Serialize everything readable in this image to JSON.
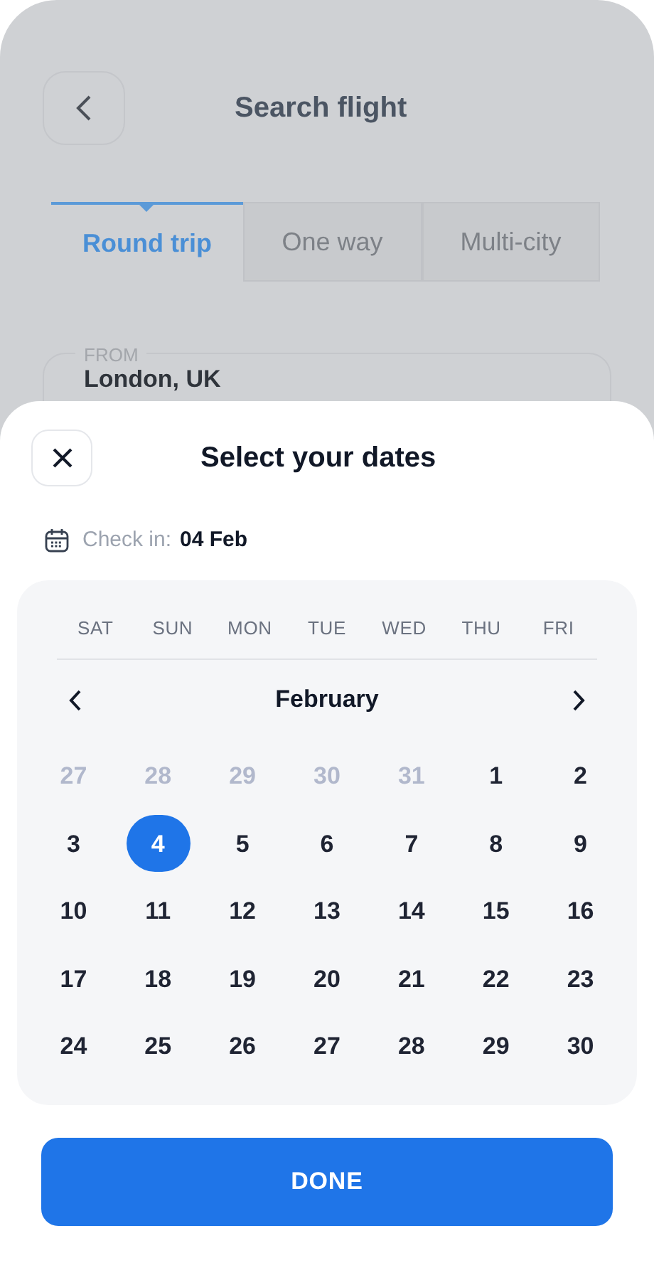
{
  "background": {
    "title": "Search flight",
    "tabs": [
      {
        "label": "Round trip",
        "selected": true
      },
      {
        "label": "One way",
        "selected": false
      },
      {
        "label": "Multi-city",
        "selected": false
      }
    ],
    "from": {
      "label": "FROM",
      "value": "London, UK"
    }
  },
  "sheet": {
    "title": "Select your dates",
    "check_in": {
      "label": "Check in:",
      "value": "04 Feb"
    },
    "weekdays": [
      "SAT",
      "SUN",
      "MON",
      "TUE",
      "WED",
      "THU",
      "FRI"
    ],
    "month": "February",
    "days": [
      {
        "label": "27",
        "muted": true,
        "selected": false
      },
      {
        "label": "28",
        "muted": true,
        "selected": false
      },
      {
        "label": "29",
        "muted": true,
        "selected": false
      },
      {
        "label": "30",
        "muted": true,
        "selected": false
      },
      {
        "label": "31",
        "muted": true,
        "selected": false
      },
      {
        "label": "1",
        "muted": false,
        "selected": false
      },
      {
        "label": "2",
        "muted": false,
        "selected": false
      },
      {
        "label": "3",
        "muted": false,
        "selected": false
      },
      {
        "label": "4",
        "muted": false,
        "selected": true
      },
      {
        "label": "5",
        "muted": false,
        "selected": false
      },
      {
        "label": "6",
        "muted": false,
        "selected": false
      },
      {
        "label": "7",
        "muted": false,
        "selected": false
      },
      {
        "label": "8",
        "muted": false,
        "selected": false
      },
      {
        "label": "9",
        "muted": false,
        "selected": false
      },
      {
        "label": "10",
        "muted": false,
        "selected": false
      },
      {
        "label": "11",
        "muted": false,
        "selected": false
      },
      {
        "label": "12",
        "muted": false,
        "selected": false
      },
      {
        "label": "13",
        "muted": false,
        "selected": false
      },
      {
        "label": "14",
        "muted": false,
        "selected": false
      },
      {
        "label": "15",
        "muted": false,
        "selected": false
      },
      {
        "label": "16",
        "muted": false,
        "selected": false
      },
      {
        "label": "17",
        "muted": false,
        "selected": false
      },
      {
        "label": "18",
        "muted": false,
        "selected": false
      },
      {
        "label": "19",
        "muted": false,
        "selected": false
      },
      {
        "label": "20",
        "muted": false,
        "selected": false
      },
      {
        "label": "21",
        "muted": false,
        "selected": false
      },
      {
        "label": "22",
        "muted": false,
        "selected": false
      },
      {
        "label": "23",
        "muted": false,
        "selected": false
      },
      {
        "label": "24",
        "muted": false,
        "selected": false
      },
      {
        "label": "25",
        "muted": false,
        "selected": false
      },
      {
        "label": "26",
        "muted": false,
        "selected": false
      },
      {
        "label": "27",
        "muted": false,
        "selected": false
      },
      {
        "label": "28",
        "muted": false,
        "selected": false
      },
      {
        "label": "29",
        "muted": false,
        "selected": false
      },
      {
        "label": "30",
        "muted": false,
        "selected": false
      }
    ],
    "button": "DONE"
  }
}
